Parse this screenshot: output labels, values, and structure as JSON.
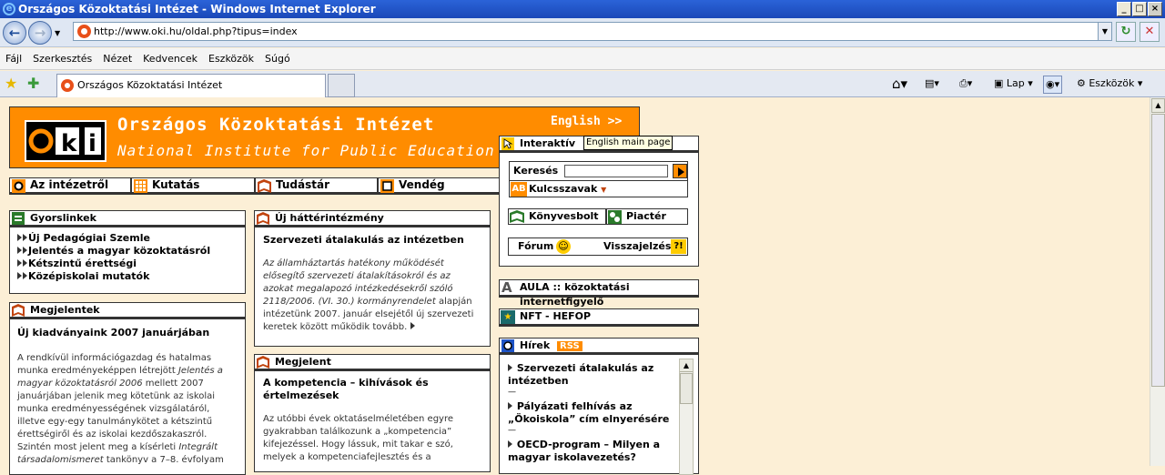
{
  "window": {
    "title": "Országos Közoktatási Intézet - Windows Internet Explorer"
  },
  "address": {
    "url": "http://www.oki.hu/oldal.php?tipus=index"
  },
  "menu": [
    "Fájl",
    "Szerkesztés",
    "Nézet",
    "Kedvencek",
    "Eszközök",
    "Súgó"
  ],
  "tab": {
    "title": "Országos Közoktatási Intézet"
  },
  "toolbar": {
    "page_label": "Lap",
    "tools_label": "Eszközök"
  },
  "header": {
    "title": "Országos Közoktatási Intézet",
    "subtitle": "National Institute for Public Education",
    "english_link": "English >>",
    "tooltip": "English main page"
  },
  "nav": [
    "Az intézetről",
    "Kutatás",
    "Tudástár",
    "Vendég"
  ],
  "gyorslinkek": {
    "title": "Gyorslinkek",
    "items": [
      "Új Pedagógiai Szemle",
      "Jelentés a magyar közoktatásról",
      "Kétszintű érettségi",
      "Középiskolai mutatók"
    ]
  },
  "megjelentek": {
    "title": "Megjelentek",
    "headline": "Új kiadványaink 2007 januárjában",
    "p1": "A rendkívül információgazdag és hatalmas munka eredményeképpen létrejött",
    "p1_it": "Jelentés a magyar közoktatásról 2006",
    "p2": "mellett 2007 januárjában jelenik meg kötetünk az iskolai munka eredményességének vizsgálatáról, illetve egy-egy tanulmánykötet a kétszintű érettségiről és az iskolai kezdőszakaszról. Szintén most jelent meg a kísérleti",
    "p2_it": "Integrált társadalomismeret",
    "p3": "tankönyv a 7–8. évfolyam"
  },
  "hatter": {
    "title": "Új háttérintézmény",
    "headline": "Szervezeti átalakulás az intézetben",
    "italic": "Az államháztartás hatékony működését elősegítő szervezeti átalakításokról és az azokat megalapozó intézkedésekről szóló 2118/2006. (VI. 30.) kormányrendelet",
    "rest": "alapján intézetünk 2007. január elsejétől új szervezeti keretek között működik tovább."
  },
  "megjelent": {
    "title": "Megjelent",
    "headline": "A kompetencia – kihívások és értelmezések",
    "text": "Az utóbbi évek oktatáselméletében egyre gyakrabban találkozunk a „kompetencia” kifejezéssel. Hogy lássuk, mit takar e szó, melyek a kompetenciafejlesztés és a"
  },
  "interaktiv": {
    "title": "Interaktív",
    "search_label": "Keresés",
    "search_value": "",
    "keywords": "Kulcsszavak",
    "konyvesbolt": "Könyvesbolt",
    "piacter": "Piactér",
    "forum": "Fórum",
    "visszajelzes": "Visszajelzés"
  },
  "aula": "AULA :: közoktatási internetfigyelő",
  "nft": "NFT - HEFOP",
  "hirek": {
    "title": "Hírek",
    "rss": "RSS",
    "items": [
      {
        "text": "Szervezeti átalakulás az intézetben",
        "dash": "—"
      },
      {
        "text": "Pályázati felhívás az „Ökoiskola” cím elnyerésére",
        "dash": "—"
      },
      {
        "text": "OECD-program – Milyen a magyar iskolavezetés?",
        "dash": ""
      }
    ]
  },
  "colors": {
    "orange": "#ff8c00",
    "titlebar": "#1e54c8",
    "page_bg": "#fcefd6"
  }
}
